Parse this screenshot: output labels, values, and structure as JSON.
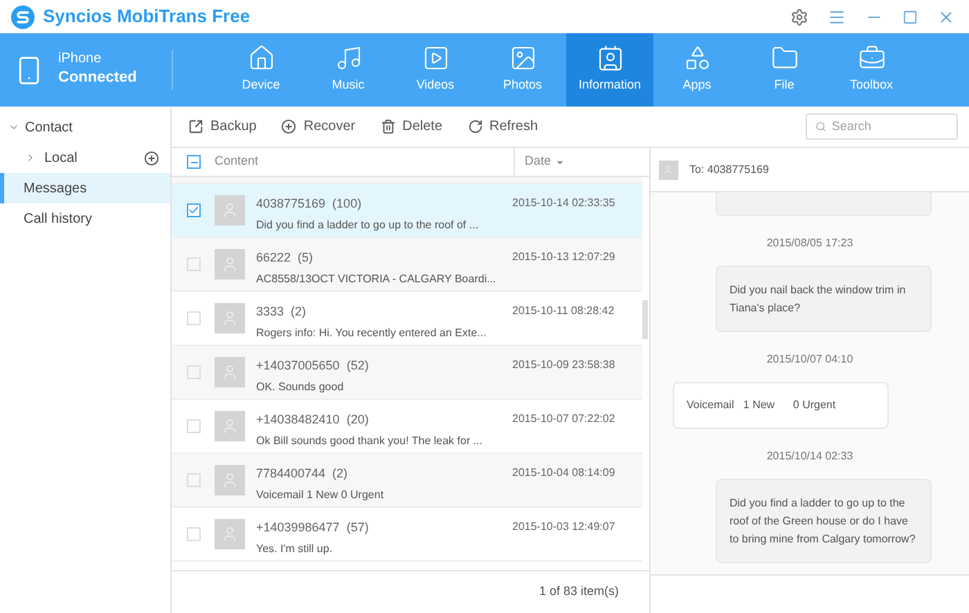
{
  "window": {
    "title": "Syncios MobiTrans Free"
  },
  "device": {
    "name": "iPhone",
    "status": "Connected"
  },
  "tabs": [
    {
      "label": "Device",
      "selected": false
    },
    {
      "label": "Music",
      "selected": false
    },
    {
      "label": "Videos",
      "selected": false
    },
    {
      "label": "Photos",
      "selected": false
    },
    {
      "label": "Information",
      "selected": true
    },
    {
      "label": "Apps",
      "selected": false
    },
    {
      "label": "File",
      "selected": false
    },
    {
      "label": "Toolbox",
      "selected": false
    }
  ],
  "sidebar": {
    "items": [
      {
        "label": "Contact",
        "selected": false,
        "expanded": true,
        "children": [
          {
            "label": "Local",
            "selected": false,
            "expanded": false
          }
        ]
      },
      {
        "label": "Messages",
        "selected": true
      },
      {
        "label": "Call history",
        "selected": false
      }
    ]
  },
  "toolbar": {
    "buttons": [
      "Backup",
      "Recover",
      "Delete",
      "Refresh"
    ],
    "search": {
      "placeholder": "Search"
    }
  },
  "table": {
    "columns": [
      "Content",
      "Date"
    ],
    "select_all_partial": true,
    "rows": [
      {
        "title": "4038775169  (100)",
        "preview": "Did you find a ladder to go up to the roof of ...",
        "date": "2015-10-14 02:33:35",
        "selected": true,
        "checked": true
      },
      {
        "title": "66222  (5)",
        "preview": "AC8558/13OCT VICTORIA - CALGARY Boardi...",
        "date": "2015-10-13 12:07:29",
        "selected": false,
        "checked": false
      },
      {
        "title": "3333  (2)",
        "preview": "Rogers info: Hi. You recently entered an Exte...",
        "date": "2015-10-11 08:28:42",
        "selected": false,
        "checked": false
      },
      {
        "title": "+14037005650  (52)",
        "preview": "OK. Sounds good",
        "date": "2015-10-09 23:58:38",
        "selected": false,
        "checked": false
      },
      {
        "title": "+14038482410  (20)",
        "preview": "Ok Bill sounds good thank you! The leak for ...",
        "date": "2015-10-07 07:22:02",
        "selected": false,
        "checked": false
      },
      {
        "title": "7784400744  (2)",
        "preview": "Voicemail 1 New 0 Urgent",
        "date": "2015-10-04 08:14:09",
        "selected": false,
        "checked": false
      },
      {
        "title": "+14039986477  (57)",
        "preview": "Yes. I'm still up.",
        "date": "2015-10-03 12:49:07",
        "selected": false,
        "checked": false
      }
    ]
  },
  "status_bar": "1 of 83 item(s)",
  "chat": {
    "recipient": "To: 4038775169",
    "messages": [
      {
        "kind": "sent",
        "time": "2015/08/05 17:23",
        "text": "Did you nail back the window trim in Tiana's place?"
      },
      {
        "kind": "received",
        "time": "2015/10/07 04:10",
        "text": "Voicemail   1 New      0 Urgent"
      },
      {
        "kind": "sent",
        "time": "2015/10/14 02:33",
        "text": "Did you find a ladder to go up to the roof of the Green house or do I have to bring mine from Calgary tomorrow?"
      }
    ]
  }
}
